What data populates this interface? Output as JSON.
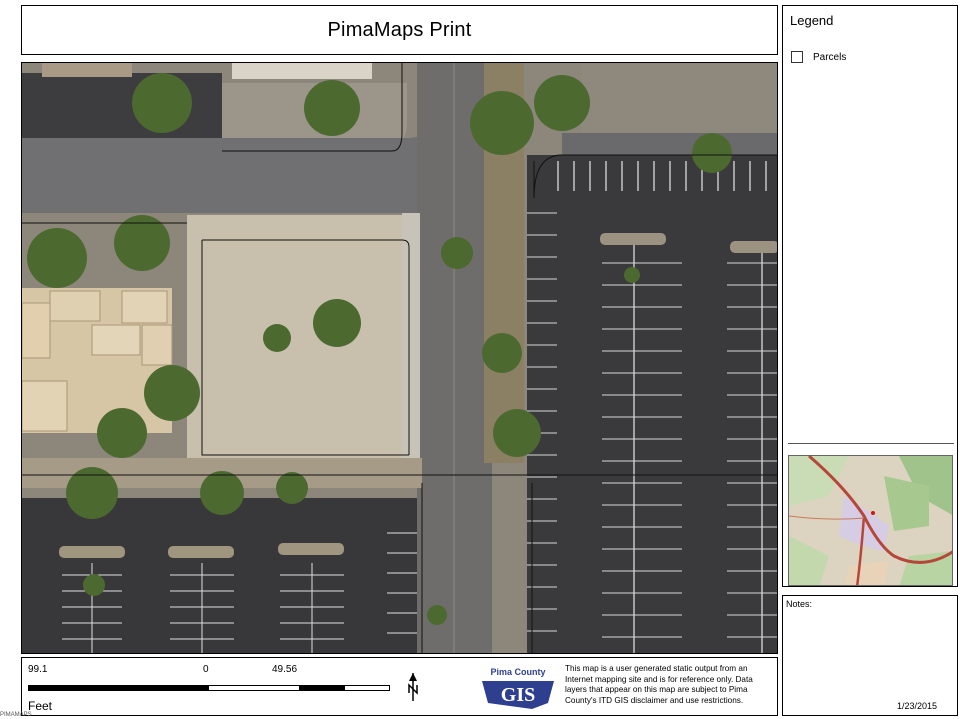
{
  "title": "PimaMaps Print",
  "legend": {
    "title": "Legend",
    "items": [
      {
        "label": "Parcels"
      }
    ]
  },
  "notes": {
    "label": "Notes:"
  },
  "date": "1/23/2015",
  "scale": {
    "left_label": "99.1",
    "zero_label": "0",
    "right_label": "49.56",
    "units": "Feet"
  },
  "logo": {
    "top_text": "Pima County",
    "main_text": "GIS"
  },
  "disclaimer": "This map is a user generated static output from an Internet mapping site and is for reference only. Data layers that appear on this map are subject to Pima County's ITD GIS disclaimer and use restrictions.",
  "footer_tag": "PIMAMAPS",
  "colors": {
    "asphalt": "#3a3a3c",
    "dirt": "#c9bfac",
    "tree": "#4d6b2f",
    "road": "#6f6c68",
    "overview_road": "#b5473a"
  },
  "icons": [
    "north-arrow-icon",
    "checkbox-icon"
  ]
}
